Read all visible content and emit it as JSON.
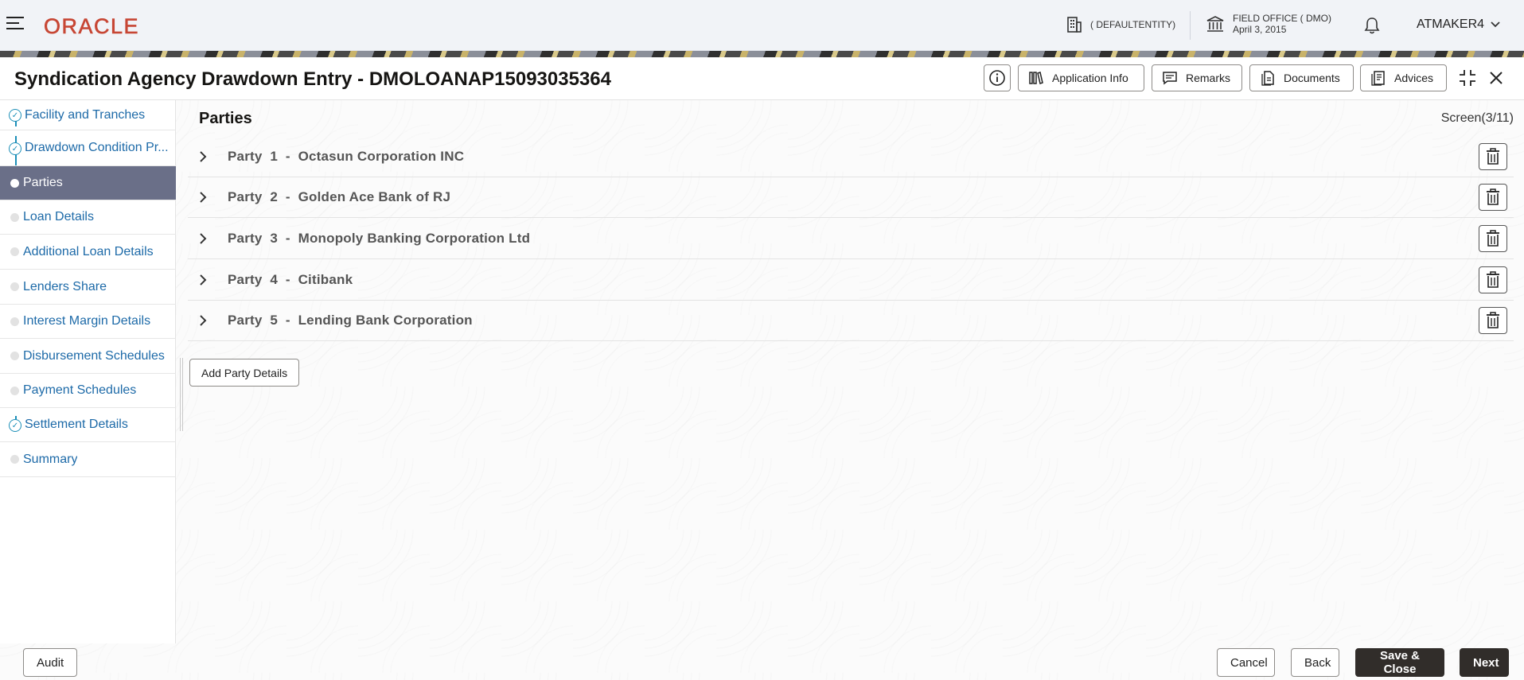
{
  "header": {
    "logo_text": "ORACLE",
    "entity": "( DEFAULTENTITY)",
    "office_name": "FIELD OFFICE ( DMO)",
    "office_date": "April 3, 2015",
    "user": "ATMAKER4"
  },
  "title_bar": {
    "title": "Syndication Agency Drawdown Entry - DMOLOANAP15093035364",
    "application_info": "Application Info",
    "remarks": "Remarks",
    "documents": "Documents",
    "advices": "Advices"
  },
  "sidebar": {
    "items": [
      {
        "label": "Facility and Tranches",
        "state": "done"
      },
      {
        "label": "Drawdown Condition Pr...",
        "state": "done"
      },
      {
        "label": "Parties",
        "state": "active"
      },
      {
        "label": "Loan Details",
        "state": "pending"
      },
      {
        "label": "Additional Loan Details",
        "state": "pending"
      },
      {
        "label": "Lenders Share",
        "state": "pending"
      },
      {
        "label": "Interest Margin Details",
        "state": "pending"
      },
      {
        "label": "Disbursement Schedules",
        "state": "pending"
      },
      {
        "label": "Payment Schedules",
        "state": "pending"
      },
      {
        "label": "Settlement Details",
        "state": "done"
      },
      {
        "label": "Summary",
        "state": "pending"
      }
    ]
  },
  "content": {
    "section_title": "Parties",
    "screen_counter": "Screen(3/11)",
    "parties": [
      {
        "label": "Party  1  -  Octasun Corporation INC"
      },
      {
        "label": "Party  2  -  Golden Ace Bank of RJ"
      },
      {
        "label": "Party  3  -  Monopoly Banking Corporation Ltd"
      },
      {
        "label": "Party  4  -  Citibank"
      },
      {
        "label": "Party  5  -  Lending Bank Corporation"
      }
    ],
    "add_party_label": "Add Party Details"
  },
  "footer": {
    "audit": "Audit",
    "cancel": "Cancel",
    "back": "Back",
    "save_close": "Save & Close",
    "next": "Next"
  },
  "colors": {
    "brand_red": "#c74634",
    "sidebar_active": "#6a6f88",
    "link_blue": "#1d6aa8",
    "dark_button": "#312d2a"
  }
}
